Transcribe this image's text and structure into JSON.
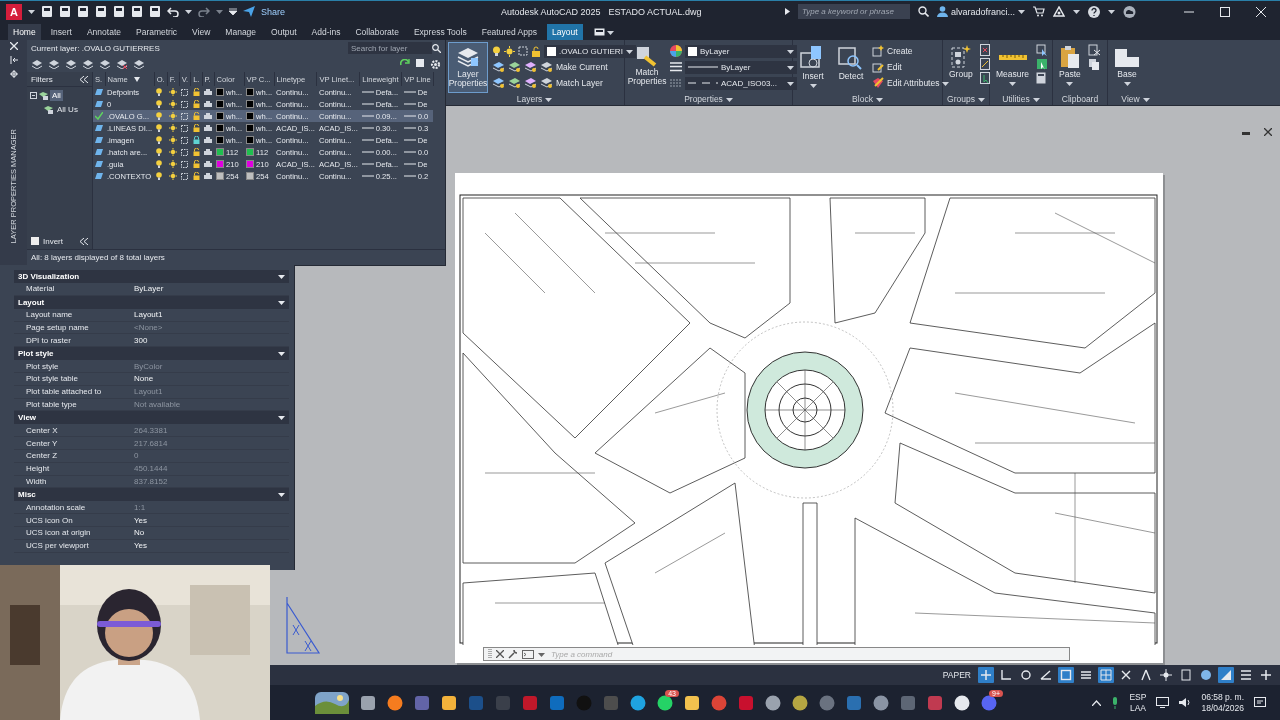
{
  "title_bar": {
    "logo_letter": "A",
    "share": "Share",
    "app": "Autodesk AutoCAD 2025",
    "file": "ESTADO ACTUAL.dwg",
    "search": {
      "placeholder": "Type a keyword or phrase"
    },
    "user": "alvaradofranci..."
  },
  "ribbon_tabs": [
    {
      "label": "Home",
      "selected": true,
      "kind": "tab"
    },
    {
      "label": "Insert",
      "selected": false,
      "kind": "tab"
    },
    {
      "label": "Annotate",
      "selected": false,
      "kind": "tab"
    },
    {
      "label": "Parametric",
      "selected": false,
      "kind": "tab"
    },
    {
      "label": "View",
      "selected": false,
      "kind": "tab"
    },
    {
      "label": "Manage",
      "selected": false,
      "kind": "tab"
    },
    {
      "label": "Output",
      "selected": false,
      "kind": "tab"
    },
    {
      "label": "Add-ins",
      "selected": false,
      "kind": "tab"
    },
    {
      "label": "Collaborate",
      "selected": false,
      "kind": "tab"
    },
    {
      "label": "Express Tools",
      "selected": false,
      "kind": "tab"
    },
    {
      "label": "Featured Apps",
      "selected": false,
      "kind": "tab"
    },
    {
      "label": "Layout",
      "selected": false,
      "kind": "contextual"
    }
  ],
  "ribbon": {
    "layers": {
      "button": "Layer Properties",
      "current_layer": ".OVALO GUTIERI",
      "make_current": "Make Current",
      "match_layer": "Match Layer",
      "label": "Layers"
    },
    "properties": {
      "button": "Match Properties",
      "color_setting": "ByLayer",
      "lineweight": "ByLayer",
      "linetype": "ACAD_ISO03...",
      "label": "Properties"
    },
    "block": {
      "insert": "Insert",
      "detect": "Detect",
      "create": "Create",
      "edit": "Edit",
      "edit_attributes": "Edit Attributes",
      "label": "Block"
    },
    "groups": {
      "button": "Group",
      "label": "Groups"
    },
    "utilities": {
      "button": "Measure",
      "label": "Utilities"
    },
    "clipboard": {
      "button": "Paste",
      "label": "Clipboard"
    },
    "view": {
      "button": "Base",
      "label": "View"
    }
  },
  "layer_manager": {
    "title": "LAYER PROPERTIES MANAGER",
    "current_layer": "Current layer: .OVALO GUTIERRES",
    "search": {
      "placeholder": "Search for layer"
    },
    "filters_header": "Filters",
    "filters": [
      {
        "label": "All",
        "selected": true,
        "children": [
          {
            "label": "All Us",
            "selected": false
          }
        ]
      }
    ],
    "invert": {
      "label": "Invert",
      "checked": false
    },
    "columns": [
      "S.",
      "Name",
      "O.",
      "F.",
      "V.",
      "L.",
      "P.",
      "Color",
      "VP C...",
      "Linetype",
      "VP Linet...",
      "Lineweight",
      "VP Line"
    ],
    "rows": [
      {
        "name": "Defpoints",
        "current": false,
        "selected": false,
        "locked": false,
        "color": "#000000",
        "color_name": "wh...",
        "vp_color_name": "wh...",
        "linetype": "Continu...",
        "vp_linetype": "Continu...",
        "lineweight": "Defa...",
        "vp_lineweight": "De"
      },
      {
        "name": "0",
        "current": false,
        "selected": false,
        "locked": false,
        "color": "#000000",
        "color_name": "wh...",
        "vp_color_name": "wh...",
        "linetype": "Continu...",
        "vp_linetype": "Continu...",
        "lineweight": "Defa...",
        "vp_lineweight": "De"
      },
      {
        "name": ".OVALO G...",
        "current": true,
        "selected": true,
        "locked": false,
        "color": "#000000",
        "color_name": "wh...",
        "vp_color_name": "wh...",
        "linetype": "Continu...",
        "vp_linetype": "Continu...",
        "lineweight": "0.09...",
        "vp_lineweight": "0.0"
      },
      {
        "name": ".LINEAS DI...",
        "current": false,
        "selected": false,
        "locked": false,
        "color": "#000000",
        "color_name": "wh...",
        "vp_color_name": "wh...",
        "linetype": "ACAD_IS...",
        "vp_linetype": "ACAD_IS...",
        "lineweight": "0.30...",
        "vp_lineweight": "0.3"
      },
      {
        "name": ".imagen",
        "current": false,
        "selected": false,
        "locked": true,
        "color": "#000000",
        "color_name": "wh...",
        "vp_color_name": "wh...",
        "linetype": "Continu...",
        "vp_linetype": "Continu...",
        "lineweight": "Defa...",
        "vp_lineweight": "De"
      },
      {
        "name": ".hatch are...",
        "current": false,
        "selected": false,
        "locked": false,
        "color": "#1fbf4f",
        "color_name": "112",
        "vp_color_name": "112",
        "linetype": "Continu...",
        "vp_linetype": "Continu...",
        "lineweight": "0.00...",
        "vp_lineweight": "0.0"
      },
      {
        "name": ".guia",
        "current": false,
        "selected": false,
        "locked": false,
        "color": "#e000e0",
        "color_name": "210",
        "vp_color_name": "210",
        "linetype": "ACAD_IS...",
        "vp_linetype": "ACAD_IS...",
        "lineweight": "Defa...",
        "vp_lineweight": "De"
      },
      {
        "name": ".CONTEXTO",
        "current": false,
        "selected": false,
        "locked": false,
        "color": "#bebebe",
        "color_name": "254",
        "vp_color_name": "254",
        "linetype": "Continu...",
        "vp_linetype": "Continu...",
        "lineweight": "0.25...",
        "vp_lineweight": "0.2"
      }
    ],
    "status": "All: 8 layers displayed of 8 total layers"
  },
  "properties": [
    {
      "title": "3D Visualization",
      "rows": [
        {
          "label": "Material",
          "value": "ByLayer",
          "disabled": false
        }
      ]
    },
    {
      "title": "Layout",
      "rows": [
        {
          "label": "Layout name",
          "value": "Layout1",
          "disabled": false
        },
        {
          "label": "Page setup name",
          "value": "<None>",
          "disabled": true
        },
        {
          "label": "DPI to raster",
          "value": "300",
          "disabled": false
        }
      ]
    },
    {
      "title": "Plot style",
      "rows": [
        {
          "label": "Plot style",
          "value": "ByColor",
          "disabled": true
        },
        {
          "label": "Plot style table",
          "value": "None",
          "disabled": false
        },
        {
          "label": "Plot table attached to",
          "value": "Layout1",
          "disabled": true
        },
        {
          "label": "Plot table type",
          "value": "Not available",
          "disabled": true
        }
      ]
    },
    {
      "title": "View",
      "rows": [
        {
          "label": "Center X",
          "value": "264.3381",
          "disabled": true
        },
        {
          "label": "Center Y",
          "value": "217.6814",
          "disabled": true
        },
        {
          "label": "Center Z",
          "value": "0",
          "disabled": true
        },
        {
          "label": "Height",
          "value": "450.1444",
          "disabled": true
        },
        {
          "label": "Width",
          "value": "837.8152",
          "disabled": true
        }
      ]
    },
    {
      "title": "Misc",
      "rows": [
        {
          "label": "Annotation scale",
          "value": "1:1",
          "disabled": true
        },
        {
          "label": "UCS icon On",
          "value": "Yes",
          "disabled": false
        },
        {
          "label": "UCS icon at origin",
          "value": "No",
          "disabled": false
        },
        {
          "label": "UCS per viewport",
          "value": "Yes",
          "disabled": false
        }
      ]
    }
  ],
  "command_line": {
    "placeholder": "Type a command"
  },
  "status_bar": {
    "space": "PAPER",
    "toggles": [
      {
        "on": true
      },
      {
        "on": false
      },
      {
        "on": false
      },
      {
        "on": false
      },
      {
        "on": true
      },
      {
        "on": false
      },
      {
        "on": true
      },
      {
        "on": false
      },
      {
        "on": false
      },
      {
        "on": false
      },
      {
        "on": false
      },
      {
        "on": false
      },
      {
        "on": true
      },
      {
        "on": false
      },
      {
        "on": false
      }
    ]
  },
  "taskbar": {
    "badges": [
      "43",
      "9+"
    ],
    "language": "ESP",
    "layout": "LAA",
    "time": "06:58 p. m.",
    "date": "18/04/2026"
  }
}
